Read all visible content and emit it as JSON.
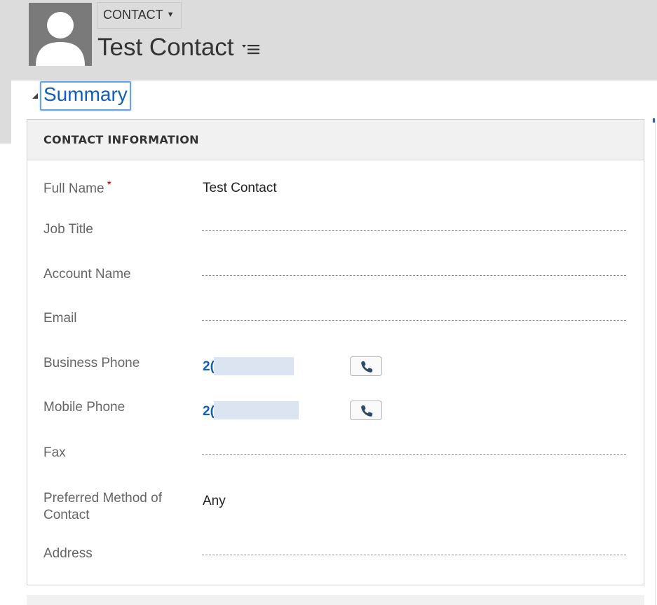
{
  "header": {
    "entity_label": "CONTACT",
    "record_title": "Test Contact",
    "avatar_icon": "user-silhouette-icon",
    "menu_icon": "menu-icon",
    "background": "#dcdcdc"
  },
  "tab": {
    "title": "Summary",
    "accent": "#1160b7",
    "toggle_icon": "triangle-expanded-icon"
  },
  "section": {
    "title": "CONTACT INFORMATION",
    "fields": {
      "full_name": {
        "label": "Full Name",
        "required_mark": "*",
        "value": "Test Contact"
      },
      "job_title": {
        "label": "Job Title",
        "value": ""
      },
      "account_name": {
        "label": "Account Name",
        "value": ""
      },
      "email": {
        "label": "Email",
        "value": ""
      },
      "business_phone": {
        "label": "Business Phone",
        "value_visible": "2(",
        "call_icon": "phone-icon"
      },
      "mobile_phone": {
        "label": "Mobile Phone",
        "value_visible": "2(",
        "call_icon": "phone-icon"
      },
      "fax": {
        "label": "Fax",
        "value": ""
      },
      "preferred_method": {
        "label": "Preferred Method of Contact",
        "value": "Any"
      },
      "address": {
        "label": "Address",
        "value": ""
      }
    }
  },
  "colors": {
    "link": "#1160b7",
    "required": "#c80000",
    "label": "#666666",
    "section_header_bg": "#f1f1f1"
  }
}
